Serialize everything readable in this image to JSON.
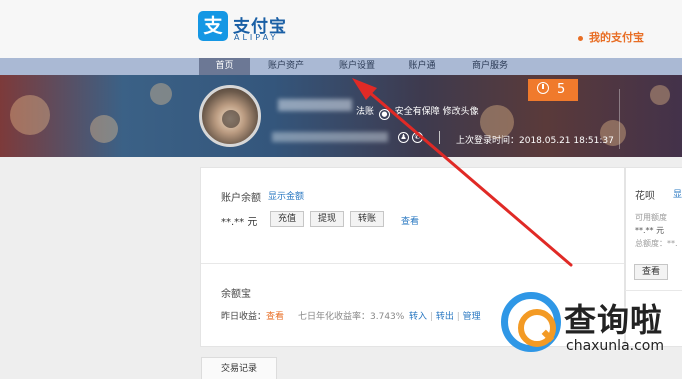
{
  "header": {
    "logo_text_cn": "支付宝",
    "logo_text_en": "ALIPAY",
    "logo_glyph": "支",
    "my_alipay": "我的支付宝"
  },
  "nav": {
    "items": [
      {
        "label": "首页",
        "active": true
      },
      {
        "label": "账户资产",
        "active": false
      },
      {
        "label": "账户设置",
        "active": false
      },
      {
        "label": "账户通",
        "active": false
      },
      {
        "label": "商户服务",
        "active": false
      }
    ]
  },
  "banner": {
    "security_text": "安全有保障",
    "security_prefix": "法账",
    "edit_avatar": "修改头像",
    "last_login": "上次登录时间：2018.05.21 18:51:37",
    "alarm_count": "5"
  },
  "balance": {
    "title": "账户余额",
    "show_amount": "显示金额",
    "amount": "**.** 元",
    "buttons": [
      "充值",
      "提现",
      "转账"
    ],
    "view": "查看"
  },
  "yuebao": {
    "title": "余额宝",
    "yesterday_label": "昨日收益：",
    "yesterday_value": "查看",
    "rate": "七日年化收益率：3.743%",
    "links": [
      "转入",
      "转出",
      "管理"
    ]
  },
  "huabei": {
    "title": "花呗",
    "show": "显示金",
    "available_label": "可用额度",
    "available_value": "**.** 元",
    "total_label": "总额度：**.",
    "view_button": "查看"
  },
  "transactions": {
    "tab_label": "交易记录"
  },
  "watermark": {
    "cn": "查询啦",
    "en": "chaxunla.com"
  },
  "colors": {
    "brand_blue": "#1597e4",
    "accent_orange": "#f07a2c",
    "nav_bg": "#aab9d4",
    "annotation_red": "#e02a26"
  }
}
